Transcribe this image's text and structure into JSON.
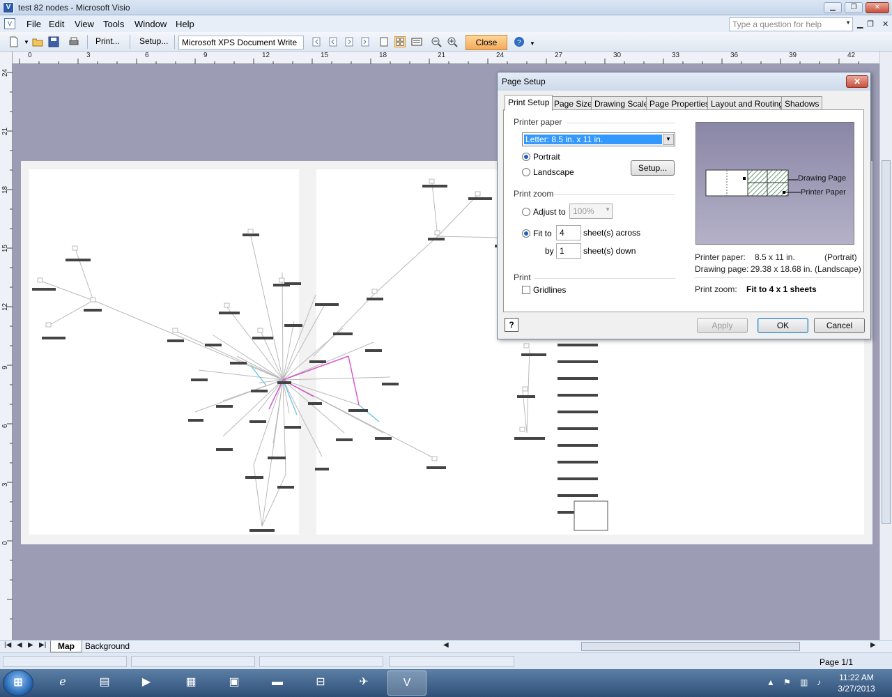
{
  "window": {
    "title": "test 82 nodes - Microsoft Visio",
    "help_placeholder": "Type a question for help"
  },
  "menu": [
    "File",
    "Edit",
    "View",
    "Tools",
    "Window",
    "Help"
  ],
  "toolbar": {
    "print_label": "Print...",
    "setup_label": "Setup...",
    "printer": "Microsoft XPS Document Write",
    "close_label": "Close"
  },
  "ruler": {
    "horizontal": [
      "0",
      "3",
      "6",
      "9",
      "12",
      "15",
      "18",
      "21",
      "24",
      "27",
      "30",
      "33",
      "36",
      "39",
      "42"
    ],
    "vertical": [
      "24",
      "21",
      "18",
      "15",
      "12",
      "9",
      "6",
      "3",
      "0"
    ]
  },
  "page_tabs": [
    "Map",
    "Background"
  ],
  "status": {
    "page": "Page 1/1"
  },
  "taskbar": {
    "time": "11:22 AM",
    "date": "3/27/2013"
  },
  "dialog": {
    "title": "Page Setup",
    "tabs": [
      "Print Setup",
      "Page Size",
      "Drawing Scale",
      "Page Properties",
      "Layout and Routing",
      "Shadows"
    ],
    "printer_paper_label": "Printer paper",
    "paper_value": "Letter:  8.5 in. x 11 in.",
    "portrait": "Portrait",
    "landscape": "Landscape",
    "setup_button": "Setup...",
    "print_zoom_label": "Print zoom",
    "adjust_to": "Adjust to",
    "adjust_value": "100%",
    "fit_to": "Fit to",
    "sheets_across_value": "4",
    "sheets_across_label": "sheet(s) across",
    "by_label": "by",
    "sheets_down_value": "1",
    "sheets_down_label": "sheet(s) down",
    "print_label": "Print",
    "gridlines": "Gridlines",
    "preview_drawing_page": "Drawing Page",
    "preview_printer_paper": "Printer Paper",
    "printer_paper_info_label": "Printer paper:",
    "printer_paper_info_value": "8.5 x 11 in.",
    "printer_paper_orientation": "(Portrait)",
    "drawing_page_info_label": "Drawing page:",
    "drawing_page_info_value": "29.38 x 18.68 in.",
    "drawing_page_orientation": "(Landscape)",
    "print_zoom_info_label": "Print zoom:",
    "print_zoom_info_value": "Fit to 4 x 1 sheets",
    "apply": "Apply",
    "ok": "OK",
    "cancel": "Cancel"
  }
}
